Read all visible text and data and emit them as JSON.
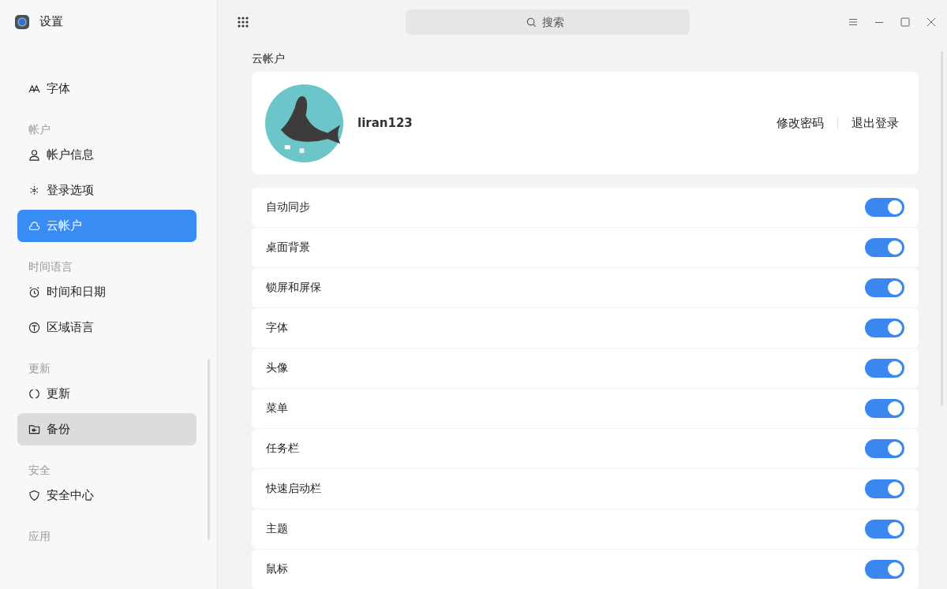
{
  "window": {
    "title": "设置"
  },
  "search": {
    "placeholder": "搜索"
  },
  "sidebar": {
    "groups": [
      {
        "items": [
          {
            "label": "字体",
            "kind": "font",
            "selected": false,
            "hovered": false
          }
        ]
      },
      {
        "heading": "帐户",
        "items": [
          {
            "label": "帐户信息",
            "kind": "user",
            "selected": false,
            "hovered": false
          },
          {
            "label": "登录选项",
            "kind": "login",
            "selected": false,
            "hovered": false
          },
          {
            "label": "云帐户",
            "kind": "cloud",
            "selected": true,
            "hovered": false
          }
        ]
      },
      {
        "heading": "时间语言",
        "items": [
          {
            "label": "时间和日期",
            "kind": "clock",
            "selected": false,
            "hovered": false
          },
          {
            "label": "区域语言",
            "kind": "region",
            "selected": false,
            "hovered": false
          }
        ]
      },
      {
        "heading": "更新",
        "items": [
          {
            "label": "更新",
            "kind": "update",
            "selected": false,
            "hovered": false
          },
          {
            "label": "备份",
            "kind": "backup",
            "selected": false,
            "hovered": true
          }
        ]
      },
      {
        "heading": "安全",
        "items": [
          {
            "label": "安全中心",
            "kind": "shield",
            "selected": false,
            "hovered": false
          }
        ]
      },
      {
        "heading": "应用"
      }
    ]
  },
  "section_title": "云帐户",
  "account": {
    "username": "liran123",
    "actions": [
      "修改密码",
      "退出登录"
    ]
  },
  "sync_items": [
    {
      "label": "自动同步",
      "on": true
    },
    {
      "label": "桌面背景",
      "on": true
    },
    {
      "label": "锁屏和屏保",
      "on": true
    },
    {
      "label": "字体",
      "on": true
    },
    {
      "label": "头像",
      "on": true
    },
    {
      "label": "菜单",
      "on": true
    },
    {
      "label": "任务栏",
      "on": true
    },
    {
      "label": "快速启动栏",
      "on": true
    },
    {
      "label": "主题",
      "on": true
    },
    {
      "label": "鼠标",
      "on": true
    }
  ]
}
